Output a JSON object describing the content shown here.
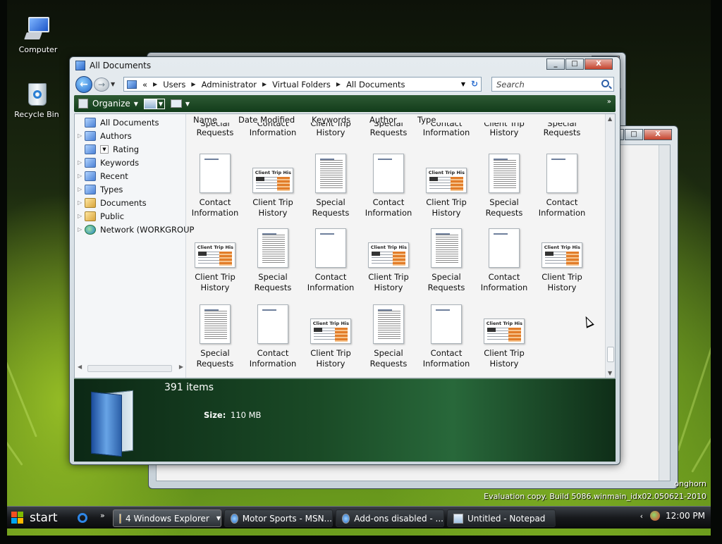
{
  "desktop": {
    "icons": [
      {
        "label": "Computer"
      },
      {
        "label": "Recycle Bin"
      }
    ],
    "watermark_partial": "onghorn",
    "evaluation_text": "Evaluation copy. Build 5086.winmain_idx02.050621-2010"
  },
  "window": {
    "title": "All Documents",
    "caption_buttons": {
      "minimize": "_",
      "maximize": "□",
      "close": "X"
    },
    "address": {
      "overflow": "«",
      "crumbs": [
        "Users",
        "Administrator",
        "Virtual Folders",
        "All Documents"
      ]
    },
    "search": {
      "placeholder": "Search"
    },
    "command_bar": {
      "organize": "Organize",
      "more": "»"
    },
    "nav_pane": {
      "items": [
        {
          "label": "All Documents"
        },
        {
          "label": "Authors"
        },
        {
          "label": "Rating"
        },
        {
          "label": "Keywords"
        },
        {
          "label": "Recent"
        },
        {
          "label": "Types"
        },
        {
          "label": "Documents"
        },
        {
          "label": "Public"
        },
        {
          "label": "Network (WORKGROUP"
        }
      ]
    },
    "columns": [
      "Name",
      "Date Modified",
      "Keywords",
      "Author",
      "Type"
    ],
    "partial_row": [
      {
        "line1": "Special",
        "line2": "Requests"
      },
      {
        "line1": "Contact",
        "line2": "Information"
      },
      {
        "line1": "Client Trip",
        "line2": "History"
      },
      {
        "line1": "Special",
        "line2": "Requests"
      },
      {
        "line1": "Contact",
        "line2": "Information"
      },
      {
        "line1": "Client Trip",
        "line2": "History"
      },
      {
        "line1": "Special",
        "line2": "Requests"
      }
    ],
    "files": {
      "thumbnail_title": "Client Trip His",
      "rows": [
        [
          {
            "type": "contact",
            "line1": "Contact",
            "line2": "Information"
          },
          {
            "type": "client",
            "line1": "Client Trip",
            "line2": "History"
          },
          {
            "type": "special",
            "line1": "Special",
            "line2": "Requests"
          },
          {
            "type": "contact",
            "line1": "Contact",
            "line2": "Information"
          },
          {
            "type": "client",
            "line1": "Client Trip",
            "line2": "History"
          },
          {
            "type": "special",
            "line1": "Special",
            "line2": "Requests"
          },
          {
            "type": "contact",
            "line1": "Contact",
            "line2": "Information"
          }
        ],
        [
          {
            "type": "client",
            "line1": "Client Trip",
            "line2": "History"
          },
          {
            "type": "special",
            "line1": "Special",
            "line2": "Requests"
          },
          {
            "type": "contact",
            "line1": "Contact",
            "line2": "Information"
          },
          {
            "type": "client",
            "line1": "Client Trip",
            "line2": "History"
          },
          {
            "type": "special",
            "line1": "Special",
            "line2": "Requests"
          },
          {
            "type": "contact",
            "line1": "Contact",
            "line2": "Information"
          },
          {
            "type": "client",
            "line1": "Client Trip",
            "line2": "History"
          }
        ],
        [
          {
            "type": "special",
            "line1": "Special",
            "line2": "Requests"
          },
          {
            "type": "contact",
            "line1": "Contact",
            "line2": "Information"
          },
          {
            "type": "client",
            "line1": "Client Trip",
            "line2": "History"
          },
          {
            "type": "special",
            "line1": "Special",
            "line2": "Requests"
          },
          {
            "type": "contact",
            "line1": "Contact",
            "line2": "Information"
          },
          {
            "type": "client",
            "line1": "Client Trip",
            "line2": "History"
          }
        ]
      ]
    },
    "details": {
      "items_count": "391 items",
      "size_label": "Size:",
      "size_value": "110 MB"
    }
  },
  "taskbar": {
    "start_label": "start",
    "quicklaunch_more": "»",
    "buttons": [
      {
        "label": "4 Windows Explorer",
        "icon": "folder-icon",
        "active": true
      },
      {
        "label": "Motor Sports - MSN...",
        "icon": "ie-icon"
      },
      {
        "label": "Add-ons disabled - ...",
        "icon": "ie-icon"
      },
      {
        "label": "Untitled - Notepad",
        "icon": "notepad-icon"
      }
    ],
    "tray": {
      "arrow": "‹",
      "clock": "12:00 PM"
    }
  },
  "colors": {
    "command_bar": "#1f4a27",
    "details_pane": "#1a4a26",
    "accent_blue": "#2b66c8",
    "thumbnail_orange": "#e27d2a"
  }
}
